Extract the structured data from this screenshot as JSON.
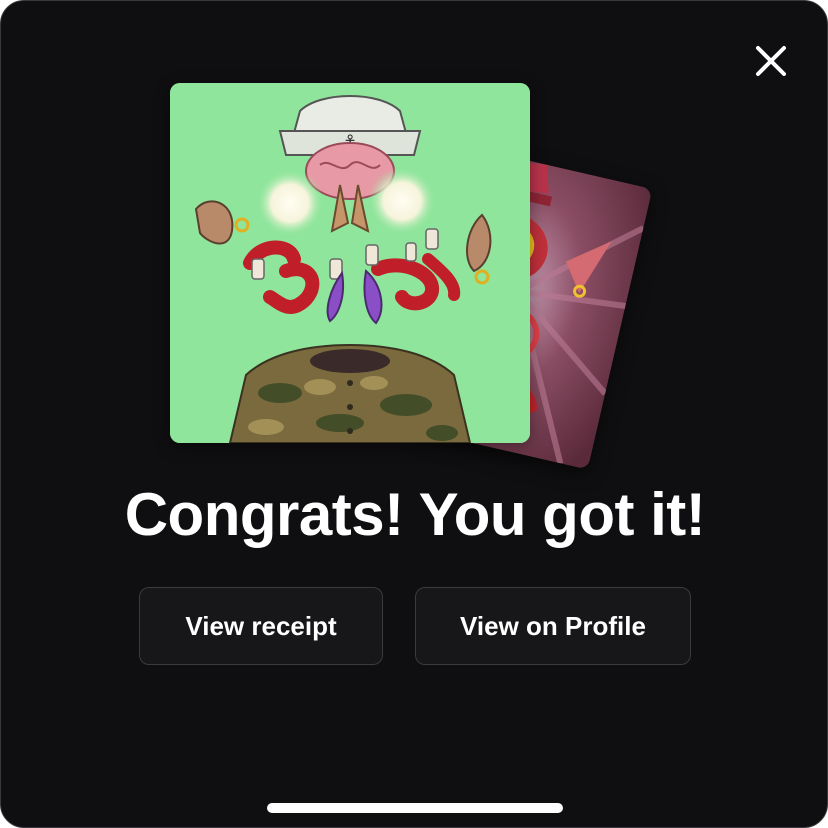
{
  "modal": {
    "headline": "Congrats! You got it!",
    "close_icon": "close-icon",
    "buttons": {
      "receipt_label": "View receipt",
      "profile_label": "View on Profile"
    }
  },
  "artwork": {
    "front_card": "nft-artwork-front",
    "back_card": "nft-artwork-back",
    "colors": {
      "front_background": "#8ee59b",
      "back_background": "#7a3f52",
      "modal_background": "#0f0f11",
      "button_background": "#17171a",
      "button_border": "#3a3a3f"
    }
  }
}
